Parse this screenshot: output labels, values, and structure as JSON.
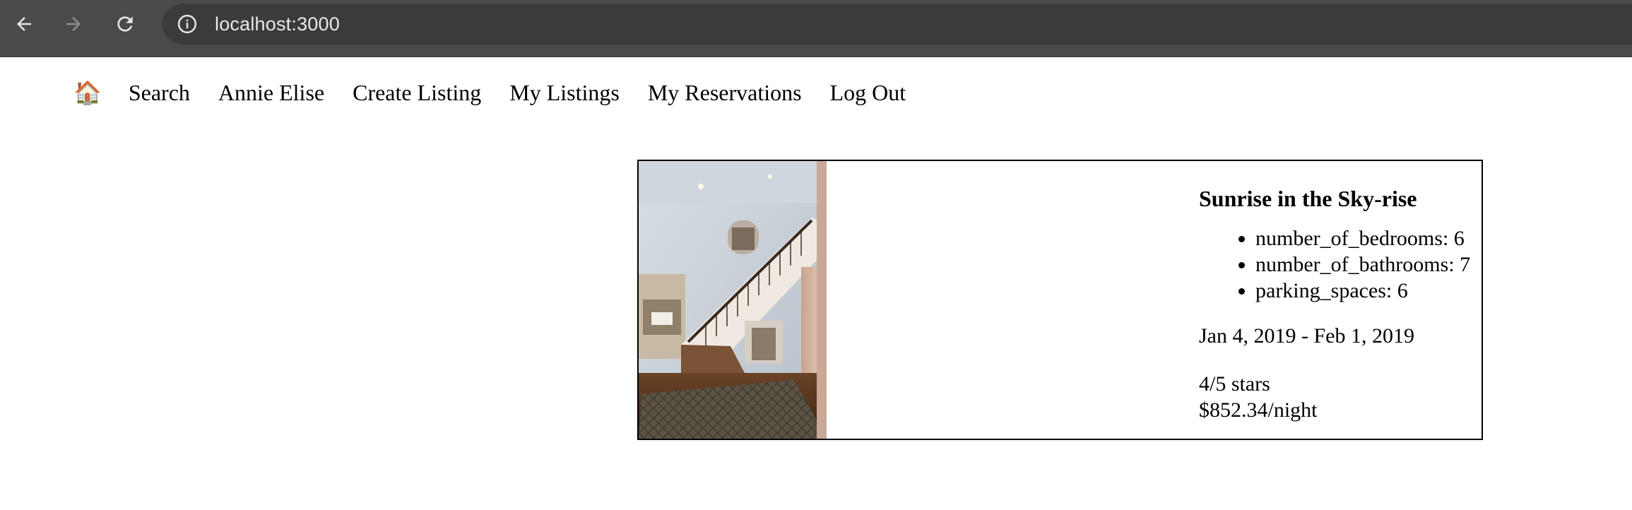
{
  "browser": {
    "url": "localhost:3000",
    "back_icon": "arrow-left-icon",
    "forward_icon": "arrow-right-icon",
    "reload_icon": "reload-icon",
    "site_info_icon": "info-icon"
  },
  "nav": {
    "home_icon": "🏠",
    "links": [
      "Search",
      "Annie Elise",
      "Create Listing",
      "My Listings",
      "My Reservations",
      "Log Out"
    ]
  },
  "listing": {
    "title": "Sunrise in the Sky-rise",
    "features": [
      "number_of_bedrooms: 6",
      "number_of_bathrooms: 7",
      "parking_spaces: 6"
    ],
    "dates": "Jan 4, 2019 - Feb 1, 2019",
    "rating": "4/5 stars",
    "rating_value": 4,
    "rating_max": 5,
    "price": "$852.34/night"
  }
}
